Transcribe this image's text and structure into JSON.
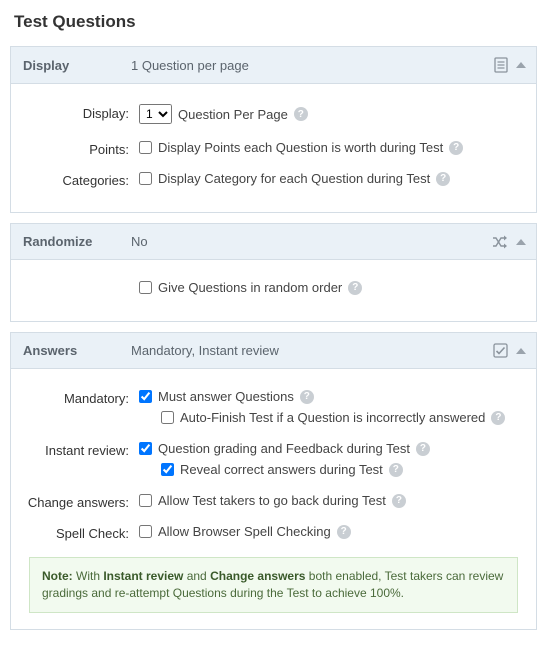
{
  "page": {
    "title": "Test Questions"
  },
  "display": {
    "bar_label": "Display",
    "summary": "1 Question per page",
    "row_display_label": "Display:",
    "select_value": "1",
    "select_options": [
      "1"
    ],
    "per_page_suffix": "Question Per Page",
    "row_points_label": "Points:",
    "points_text": "Display Points each Question is worth during Test",
    "points_checked": false,
    "row_categories_label": "Categories:",
    "categories_text": "Display Category for each Question during Test",
    "categories_checked": false
  },
  "randomize": {
    "bar_label": "Randomize",
    "summary": "No",
    "random_text": "Give Questions in random order",
    "random_checked": false
  },
  "answers": {
    "bar_label": "Answers",
    "summary": "Mandatory, Instant review",
    "row_mandatory_label": "Mandatory:",
    "mandatory_text": "Must answer Questions",
    "mandatory_checked": true,
    "autofinish_text": "Auto-Finish Test if a Question is incorrectly answered",
    "autofinish_checked": false,
    "row_instant_label": "Instant review:",
    "instant_text": "Question grading and Feedback during Test",
    "instant_checked": true,
    "reveal_text": "Reveal correct answers during Test",
    "reveal_checked": true,
    "row_change_label": "Change answers:",
    "change_text": "Allow Test takers to go back during Test",
    "change_checked": false,
    "row_spell_label": "Spell Check:",
    "spell_text": "Allow Browser Spell Checking",
    "spell_checked": false
  },
  "note": {
    "prefix": "Note:",
    "text_a": " With ",
    "b1": "Instant review",
    "text_b": " and ",
    "b2": "Change answers",
    "text_c": " both enabled, Test takers can review gradings and re-attempt Questions during the Test to achieve 100%."
  }
}
